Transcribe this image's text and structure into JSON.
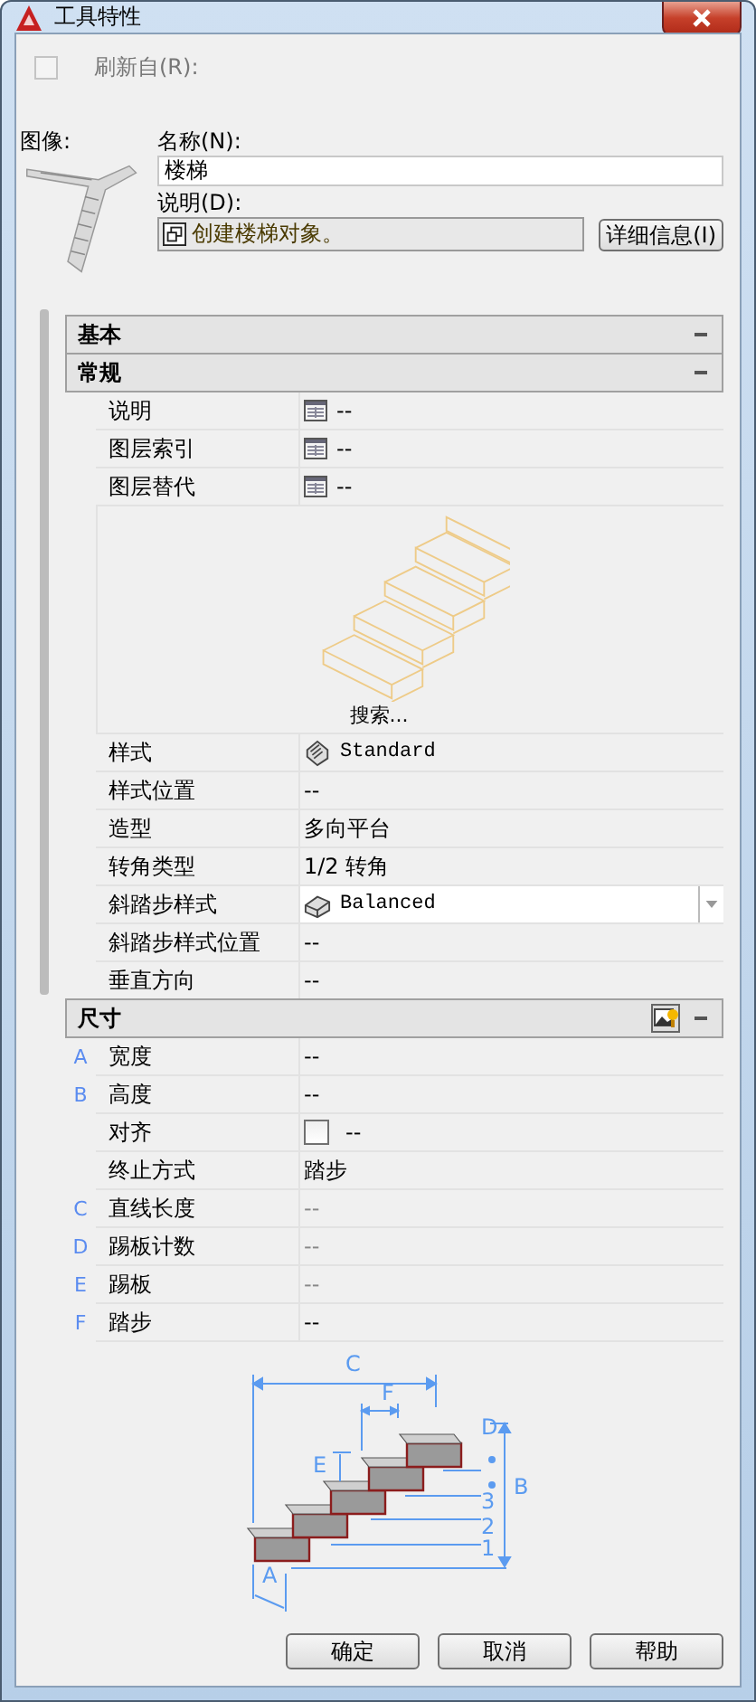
{
  "window": {
    "title": "工具特性"
  },
  "refresh": {
    "label": "刷新自(R):",
    "checked": false,
    "disabled": true
  },
  "image_label": "图像:",
  "name": {
    "label": "名称(N):",
    "value": "楼梯"
  },
  "description": {
    "label": "说明(D):",
    "value": "创建楼梯对象。",
    "button": "详细信息(I)"
  },
  "sections": [
    {
      "title": "基本",
      "expanded": true,
      "tool_icon": false
    },
    {
      "title": "常规",
      "expanded": true,
      "tool_icon": false,
      "rows": [
        {
          "kind": "list",
          "label": "说明",
          "value": "--"
        },
        {
          "kind": "list",
          "label": "图层索引",
          "value": "--"
        },
        {
          "kind": "list",
          "label": "图层替代",
          "value": "--"
        },
        {
          "kind": "preview",
          "caption": "搜索..."
        },
        {
          "kind": "style",
          "label": "样式",
          "value": "Standard"
        },
        {
          "kind": "text",
          "label": "样式位置",
          "value": "--"
        },
        {
          "kind": "text",
          "label": "造型",
          "value": "多向平台"
        },
        {
          "kind": "text",
          "label": "转角类型",
          "value": "1/2 转角"
        },
        {
          "kind": "dropdown",
          "label": "斜踏步样式",
          "value": "Balanced"
        },
        {
          "kind": "text",
          "label": "斜踏步样式位置",
          "value": "--"
        },
        {
          "kind": "text",
          "label": "垂直方向",
          "value": "--"
        }
      ]
    },
    {
      "title": "尺寸",
      "expanded": true,
      "tool_icon": true,
      "rows": [
        {
          "kind": "text",
          "marker": "A",
          "label": "宽度",
          "value": "--",
          "dimmed": false
        },
        {
          "kind": "text",
          "marker": "B",
          "label": "高度",
          "value": "--",
          "dimmed": false
        },
        {
          "kind": "checkbox",
          "label": "对齐",
          "value": "--",
          "checked": false
        },
        {
          "kind": "text",
          "label": "终止方式",
          "value": "踏步",
          "dimmed": false
        },
        {
          "kind": "text",
          "marker": "C",
          "label": "直线长度",
          "value": "--",
          "dimmed": true
        },
        {
          "kind": "text",
          "marker": "D",
          "label": "踢板计数",
          "value": "--",
          "dimmed": true
        },
        {
          "kind": "text",
          "marker": "E",
          "label": "踢板",
          "value": "--",
          "dimmed": true
        },
        {
          "kind": "text",
          "marker": "F",
          "label": "踏步",
          "value": "--",
          "dimmed": false
        },
        {
          "kind": "diagram",
          "labels": [
            "C",
            "F",
            "D",
            "E",
            "B",
            "3",
            "2",
            "1",
            "A"
          ]
        }
      ]
    }
  ],
  "buttons": [
    "确定",
    "取消",
    "帮助"
  ]
}
